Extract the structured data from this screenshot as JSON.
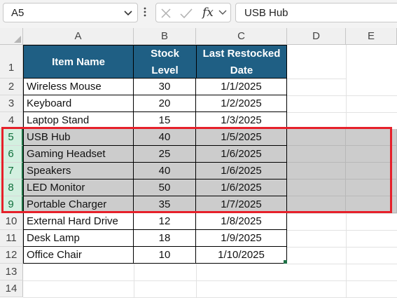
{
  "formula_bar": {
    "name_box": "A5",
    "formula": "USB Hub",
    "fx_label": "fx"
  },
  "columns": [
    "A",
    "B",
    "C",
    "D",
    "E"
  ],
  "rows": [
    "1",
    "2",
    "3",
    "4",
    "5",
    "6",
    "7",
    "8",
    "9",
    "10",
    "11",
    "12",
    "13",
    "14"
  ],
  "table": {
    "headers": {
      "item": "Item Name",
      "stock_line1": "Stock",
      "stock_line2": "Level",
      "date_line1": "Last Restocked",
      "date_line2": "Date"
    },
    "rows": [
      {
        "item": "Wireless Mouse",
        "stock": "30",
        "date": "1/1/2025"
      },
      {
        "item": "Keyboard",
        "stock": "20",
        "date": "1/2/2025"
      },
      {
        "item": "Laptop Stand",
        "stock": "15",
        "date": "1/3/2025"
      },
      {
        "item": "USB Hub",
        "stock": "40",
        "date": "1/5/2025"
      },
      {
        "item": "Gaming Headset",
        "stock": "25",
        "date": "1/6/2025"
      },
      {
        "item": "Speakers",
        "stock": "40",
        "date": "1/6/2025"
      },
      {
        "item": "LED Monitor",
        "stock": "50",
        "date": "1/6/2025"
      },
      {
        "item": "Portable Charger",
        "stock": "35",
        "date": "1/7/2025"
      },
      {
        "item": "External Hard Drive",
        "stock": "12",
        "date": "1/8/2025"
      },
      {
        "item": "Desk Lamp",
        "stock": "18",
        "date": "1/9/2025"
      },
      {
        "item": "Office Chair",
        "stock": "10",
        "date": "1/10/2025"
      }
    ]
  },
  "selection": {
    "first_row": "5",
    "last_row": "9",
    "highlight_color": "#e6202a",
    "fill_color": "#cccccc"
  },
  "colors": {
    "header_fill": "#1f5f84",
    "header_text": "#ffffff",
    "selected_row_header": "#d3f0e0"
  }
}
